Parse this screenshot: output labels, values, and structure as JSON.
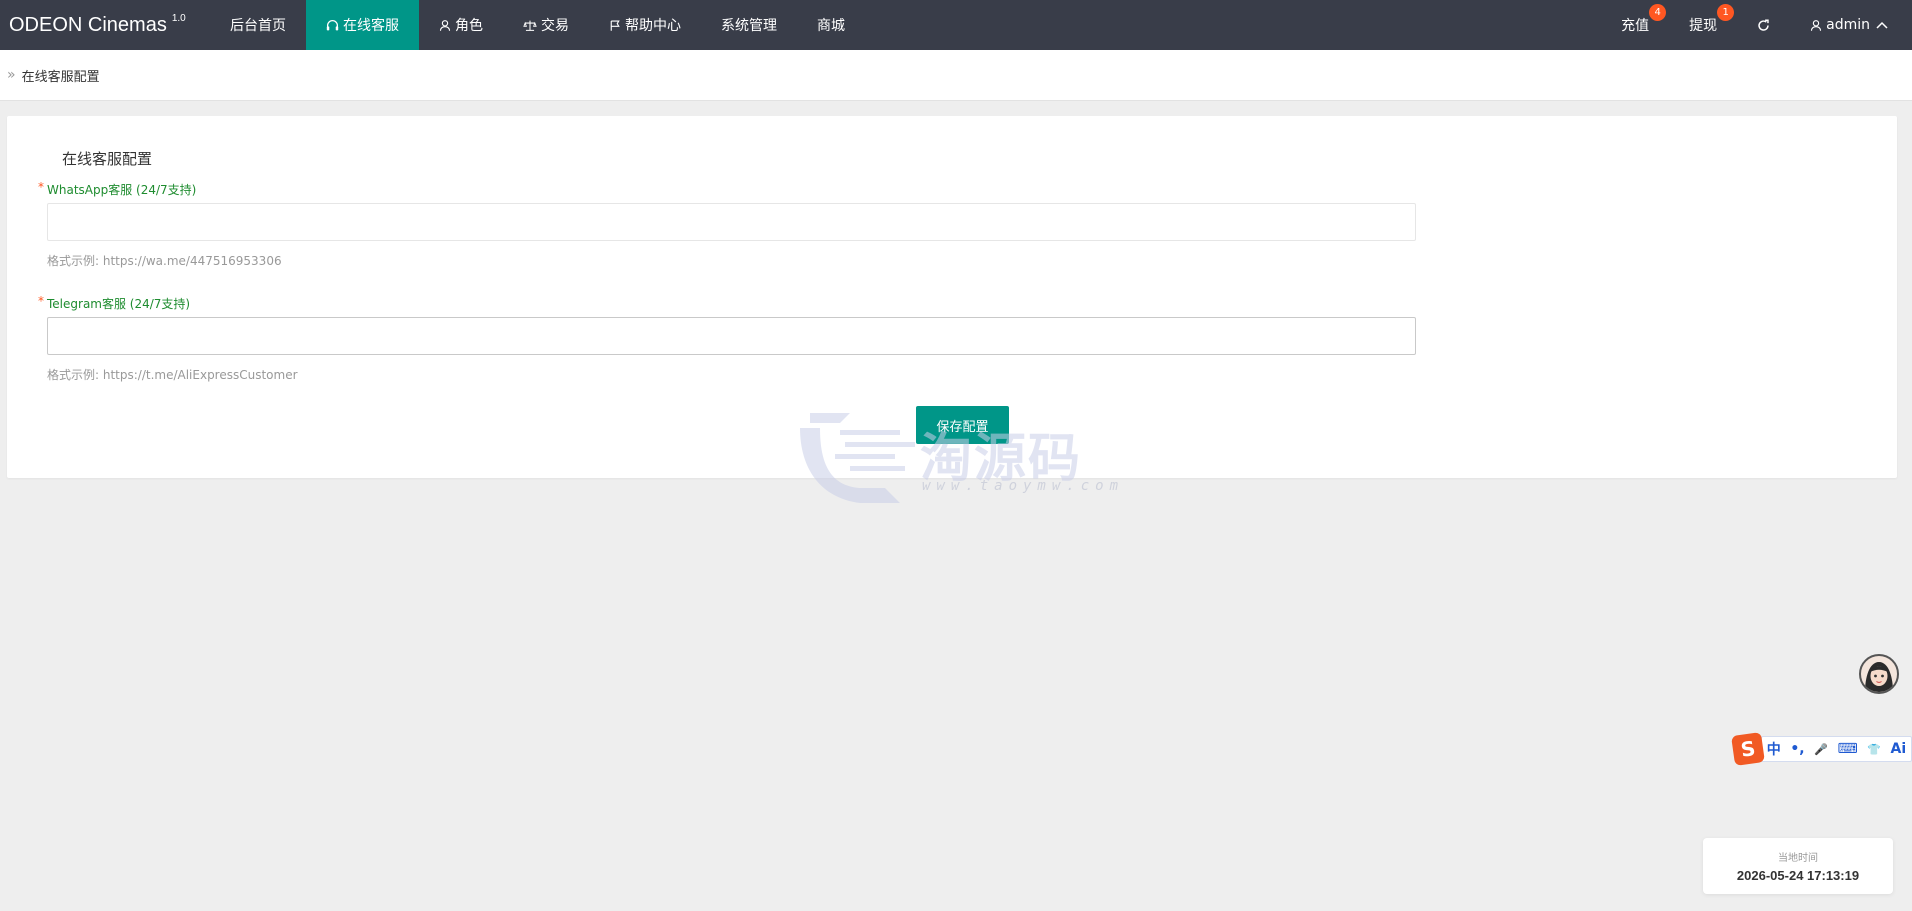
{
  "app": {
    "brand": "ODEON Cinemas",
    "version": "1.0"
  },
  "nav": {
    "items": [
      {
        "label": "后台首页",
        "icon": ""
      },
      {
        "label": "在线客服",
        "icon": "headset-icon",
        "active": true
      },
      {
        "label": "角色",
        "icon": "user-icon"
      },
      {
        "label": "交易",
        "icon": "scale-icon"
      },
      {
        "label": "帮助中心",
        "icon": "flag-icon"
      },
      {
        "label": "系统管理",
        "icon": ""
      },
      {
        "label": "商城",
        "icon": ""
      }
    ],
    "right": {
      "recharge_label": "充值",
      "recharge_badge": "4",
      "withdraw_label": "提现",
      "withdraw_badge": "1",
      "refresh_icon": "refresh-icon",
      "user_label": "admin"
    }
  },
  "breadcrumb": {
    "current": "在线客服配置"
  },
  "form": {
    "title": "在线客服配置",
    "whatsapp": {
      "label": "WhatsApp客服 (24/7支持)",
      "value": "",
      "hint": "格式示例: https://wa.me/447516953306"
    },
    "telegram": {
      "label": "Telegram客服 (24/7支持)",
      "value": "",
      "hint": "格式示例: https://t.me/AliExpressCustomer"
    },
    "save_label": "保存配置"
  },
  "watermark": {
    "text": "淘源码",
    "url": "www.taoymw.com"
  },
  "ime": {
    "logo": "S",
    "items": [
      "中",
      "•,",
      "🎤",
      "⌨",
      "👕",
      "Ai"
    ]
  },
  "clock": {
    "label": "当地时间",
    "value": "2026-05-24 17:13:19"
  },
  "colors": {
    "accent": "#009688",
    "topbar": "#393d49",
    "badge": "#ff5722",
    "label_green": "#1e8c2f"
  }
}
